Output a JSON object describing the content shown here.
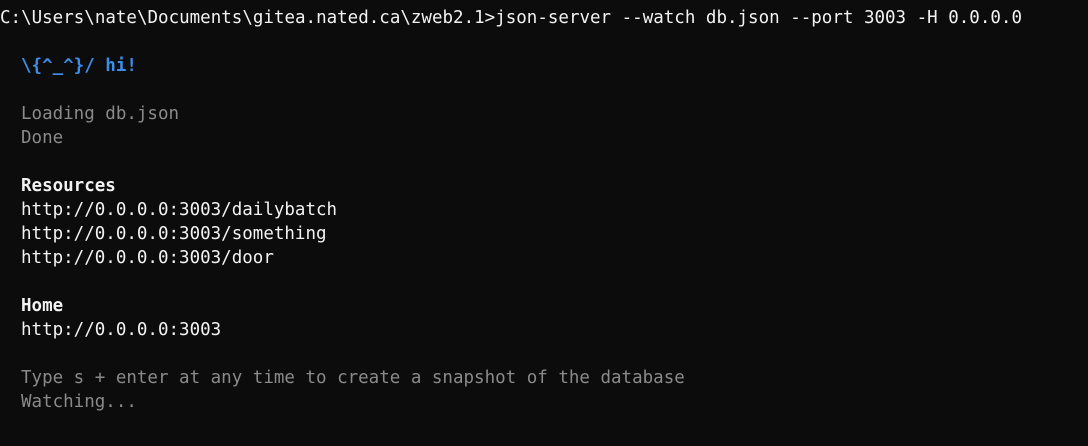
{
  "prompt": {
    "path": "C:\\Users\\nate\\Documents\\gitea.nated.ca\\zweb2.1>",
    "command": "json-server --watch db.json --port 3003 -H 0.0.0.0"
  },
  "greeting": "\\{^_^}/ hi!",
  "loading": {
    "loading_text": "Loading db.json",
    "done_text": "Done"
  },
  "resources": {
    "heading": "Resources",
    "urls": [
      "http://0.0.0.0:3003/dailybatch",
      "http://0.0.0.0:3003/something",
      "http://0.0.0.0:3003/door"
    ]
  },
  "home": {
    "heading": "Home",
    "url": "http://0.0.0.0:3003"
  },
  "footer": {
    "snapshot_hint": "Type s + enter at any time to create a snapshot of the database",
    "watching": "Watching..."
  },
  "colors": {
    "background": "#0c0c0c",
    "bright_text": "#f2f2f2",
    "dim_text": "#8a8a8a",
    "greeting_blue": "#3b8eea"
  }
}
